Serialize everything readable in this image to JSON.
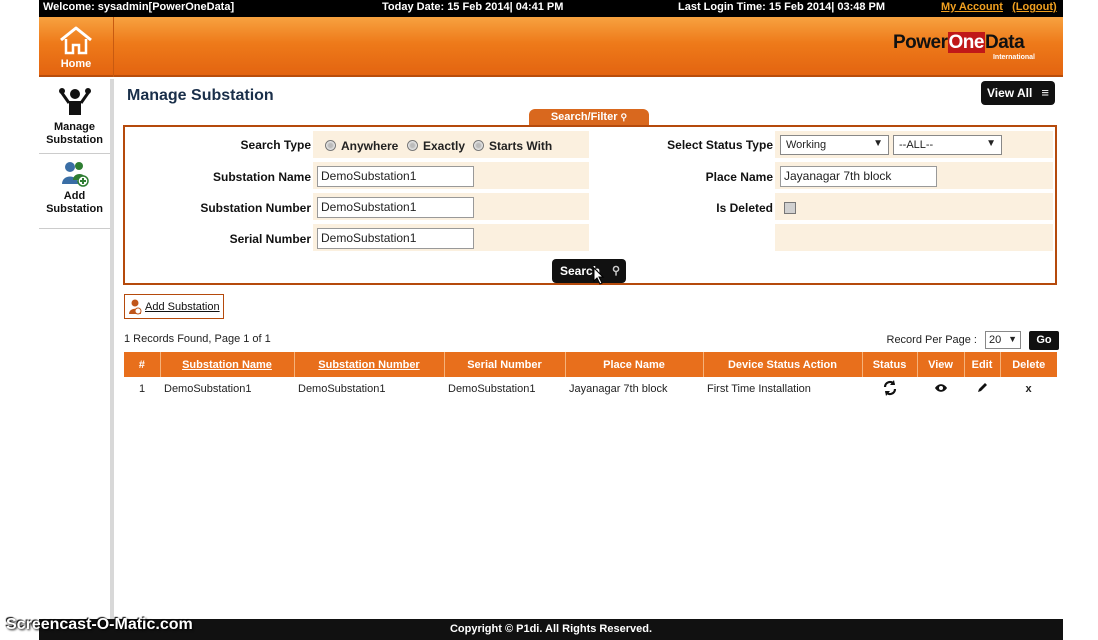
{
  "topbar": {
    "welcome": "Welcome: sysadmin[PowerOneData]",
    "today": "Today Date: 15 Feb 2014| 04:41 PM",
    "last_login": "Last Login Time: 15 Feb 2014| 03:48 PM",
    "my_account": "My Account",
    "logout": "(Logout)"
  },
  "header": {
    "home_label": "Home",
    "logo_text_1": "Power",
    "logo_text_2": "One",
    "logo_text_3": "Data",
    "logo_sub": "International"
  },
  "sidebar": {
    "items": [
      {
        "label_1": "Manage",
        "label_2": "Substation"
      },
      {
        "label_1": "Add",
        "label_2": "Substation"
      }
    ]
  },
  "page": {
    "title": "Manage Substation",
    "view_all": "View All",
    "search_filter_tab": "Search/Filter"
  },
  "filter": {
    "search_type_label": "Search Type",
    "radio_anywhere": "Anywhere",
    "radio_exactly": "Exactly",
    "radio_starts_with": "Starts With",
    "substation_name_label": "Substation Name",
    "substation_name_value": "DemoSubstation1",
    "substation_number_label": "Substation Number",
    "substation_number_value": "DemoSubstation1",
    "serial_number_label": "Serial Number",
    "serial_number_value": "DemoSubstation1",
    "status_type_label": "Select Status Type",
    "status_type_value": "Working",
    "status_all_value": "--ALL--",
    "place_name_label": "Place Name",
    "place_name_value": "Jayanagar 7th block",
    "is_deleted_label": "Is Deleted",
    "search_button": "Search"
  },
  "actions": {
    "add_substation": "Add Substation"
  },
  "list": {
    "records_text": "1 Records Found, Page 1 of 1",
    "record_per_page_label": "Record Per Page :",
    "record_per_page_value": "20",
    "go_button": "Go",
    "columns": [
      "#",
      "Substation Name",
      "Substation Number",
      "Serial Number",
      "Place Name",
      "Device Status Action",
      "Status",
      "View",
      "Edit",
      "Delete"
    ],
    "rows": [
      {
        "num": "1",
        "name": "DemoSubstation1",
        "number": "DemoSubstation1",
        "serial": "DemoSubstation1",
        "place": "Jayanagar 7th block",
        "device_status": "First Time Installation",
        "delete": "x"
      }
    ]
  },
  "footer": {
    "copyright": "Copyright © P1di. All Rights Reserved.",
    "watermark": "Screencast-O-Matic.com"
  },
  "colors": {
    "accent_orange": "#e86f1c",
    "header_orange": "#ee7a1a",
    "dark": "#111111"
  }
}
